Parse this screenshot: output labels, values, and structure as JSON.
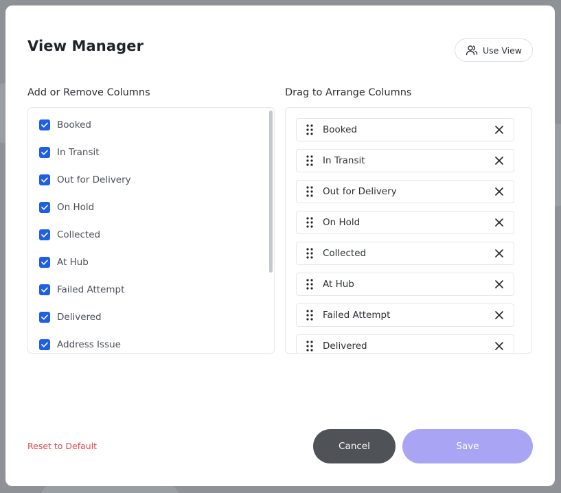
{
  "modal": {
    "title": "View Manager",
    "use_view_label": "Use View"
  },
  "left_panel": {
    "label": "Add or Remove Columns",
    "items": [
      {
        "label": "Booked",
        "checked": true
      },
      {
        "label": "In Transit",
        "checked": true
      },
      {
        "label": "Out for Delivery",
        "checked": true
      },
      {
        "label": "On Hold",
        "checked": true
      },
      {
        "label": "Collected",
        "checked": true
      },
      {
        "label": "At Hub",
        "checked": true
      },
      {
        "label": "Failed Attempt",
        "checked": true
      },
      {
        "label": "Delivered",
        "checked": true
      },
      {
        "label": "Address Issue",
        "checked": true
      }
    ]
  },
  "right_panel": {
    "label": "Drag to Arrange Columns",
    "items": [
      {
        "label": "Booked"
      },
      {
        "label": "In Transit"
      },
      {
        "label": "Out for Delivery"
      },
      {
        "label": "On Hold"
      },
      {
        "label": "Collected"
      },
      {
        "label": "At Hub"
      },
      {
        "label": "Failed Attempt"
      },
      {
        "label": "Delivered"
      }
    ]
  },
  "footer": {
    "reset_label": "Reset to Default",
    "cancel_label": "Cancel",
    "save_label": "Save"
  },
  "colors": {
    "checkbox": "#1f5fe3",
    "cancel_bg": "#4f5256",
    "save_bg": "#a9a4f4",
    "reset_text": "#e5484d"
  }
}
